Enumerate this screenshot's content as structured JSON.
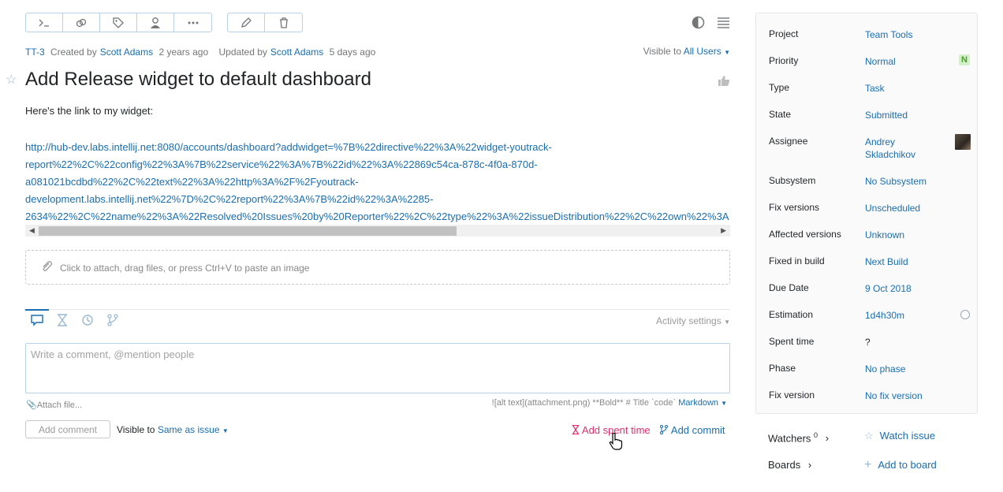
{
  "toolbar": {
    "group1_icons": [
      "command-icon",
      "link-icon",
      "tag-icon",
      "user-icon",
      "more-icon"
    ],
    "group2_icons": [
      "pencil-icon",
      "trash-icon"
    ]
  },
  "meta": {
    "id": "TT-3",
    "created_prefix": "Created by",
    "creator": "Scott Adams",
    "created_ago": "2 years ago",
    "updated_prefix": "Updated by",
    "updater": "Scott Adams",
    "updated_ago": "5 days ago"
  },
  "visibility": {
    "prefix": "Visible to",
    "value": "All Users"
  },
  "issue": {
    "title": "Add Release widget to default dashboard",
    "description": "Here's the link to my widget:",
    "url_lines": [
      "http://hub-dev.labs.intellij.net:8080/accounts/dashboard?addwidget=%7B%22directive%22%3A%22widget-youtrack-",
      "report%22%2C%22config%22%3A%7B%22service%22%3A%7B%22id%22%3A%22869c54ca-878c-4f0a-870d-",
      "a081021bcdbd%22%2C%22text%22%3A%22http%3A%2F%2Fyoutrack-",
      "development.labs.intellij.net%22%7D%2C%22report%22%3A%7B%22id%22%3A%2285-",
      "2634%22%2C%22name%22%3A%22Resolved%20Issues%20by%20Reporter%22%2C%22type%22%3A%22issueDistribution%22%2C%22own%22%3A"
    ]
  },
  "attach": {
    "placeholder": "Click to attach, drag files, or press Ctrl+V to paste an image"
  },
  "activity": {
    "tabs": [
      "comments-icon",
      "hourglass-icon",
      "history-icon",
      "vcs-icon"
    ],
    "settings_label": "Activity settings"
  },
  "comment": {
    "placeholder": "Write a comment, @mention people",
    "attach_file": "Attach file...",
    "markdown_hint": "![alt text](attachment.png) **Bold** # Title `code`",
    "markdown_label": "Markdown",
    "add_button": "Add comment",
    "visible_prefix": "Visible to",
    "visible_value": "Same as issue",
    "add_spent_time": "Add spent time",
    "add_commit": "Add commit"
  },
  "fields": [
    {
      "label": "Project",
      "value": "Team Tools"
    },
    {
      "label": "Priority",
      "value": "Normal",
      "badge": "N"
    },
    {
      "label": "Type",
      "value": "Task"
    },
    {
      "label": "State",
      "value": "Submitted"
    },
    {
      "label": "Assignee",
      "value": "Andrey",
      "value2": "Skladchikov"
    },
    {
      "label": "Subsystem",
      "value": "No Subsystem"
    },
    {
      "label": "Fix versions",
      "value": "Unscheduled"
    },
    {
      "label": "Affected versions",
      "value": "Unknown"
    },
    {
      "label": "Fixed in build",
      "value": "Next Build"
    },
    {
      "label": "Due Date",
      "value": "9 Oct 2018"
    },
    {
      "label": "Estimation",
      "value": "1d4h30m"
    },
    {
      "label": "Spent time",
      "value": "?"
    },
    {
      "label": "Phase",
      "value": "No phase"
    },
    {
      "label": "Fix version",
      "value": "No fix version"
    }
  ],
  "sidebar_bottom": {
    "watchers_label": "Watchers",
    "watchers_count": "0",
    "boards_label": "Boards",
    "watch_issue": "Watch issue",
    "add_to_board": "Add to board"
  },
  "colors": {
    "link": "#1a6eb0",
    "spent_time": "#dd2f70",
    "badge_bg": "#d4f0c9"
  }
}
